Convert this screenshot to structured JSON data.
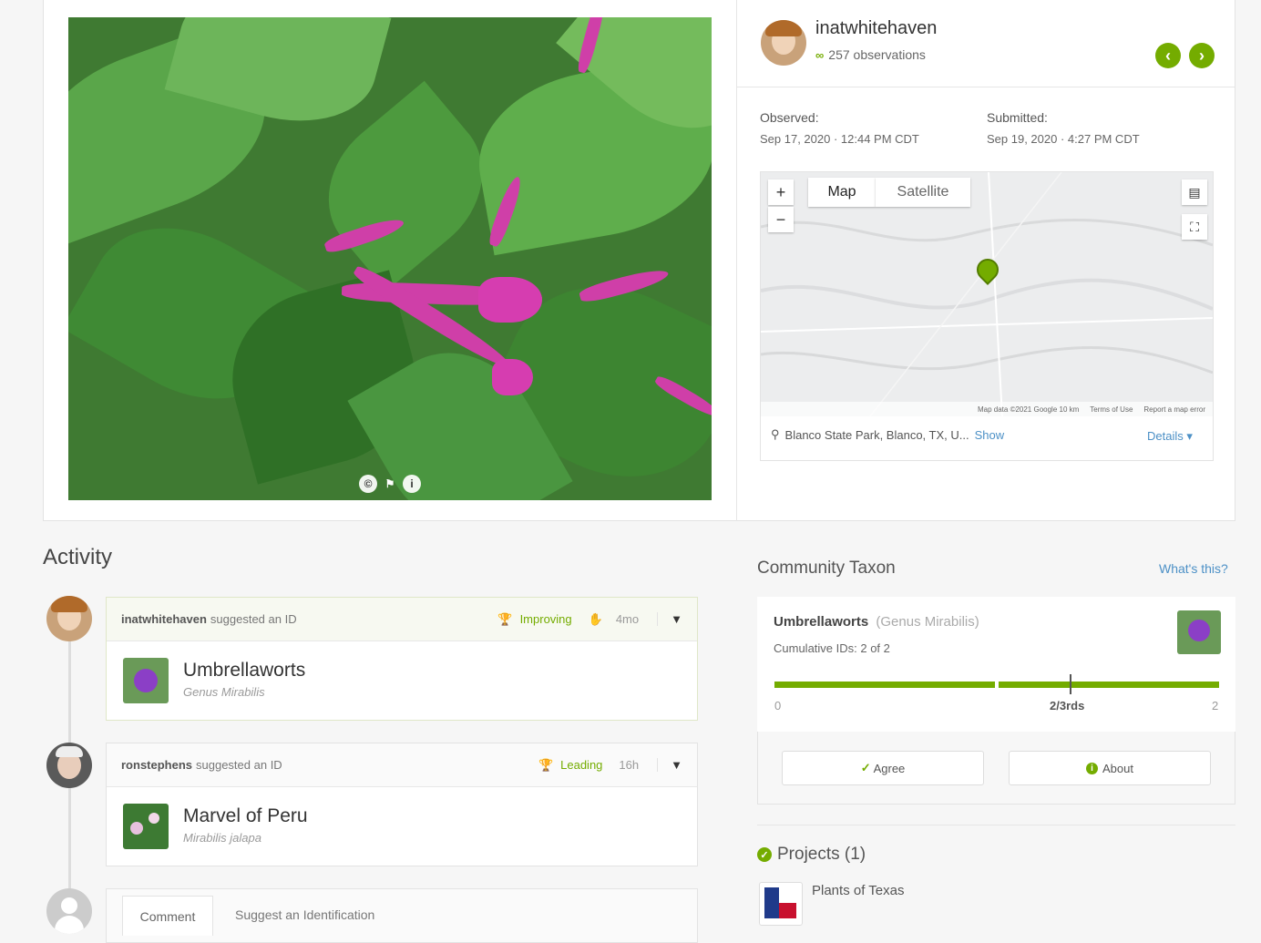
{
  "user": {
    "name": "inatwhitehaven",
    "observations": "257 observations"
  },
  "observed": {
    "label": "Observed:",
    "value": "Sep 17, 2020 · 12:44 PM CDT"
  },
  "submitted": {
    "label": "Submitted:",
    "value": "Sep 19, 2020 · 4:27 PM CDT"
  },
  "map": {
    "tab_map": "Map",
    "tab_satellite": "Satellite",
    "zoom_in": "+",
    "zoom_out": "−",
    "attribution": "Map data ©2021 Google   10 km",
    "terms": "Terms of Use",
    "report": "Report a map error",
    "location": "Blanco State Park, Blanco, TX, U...",
    "show": "Show",
    "details": "Details ▾"
  },
  "activity": {
    "title": "Activity",
    "items": [
      {
        "user": "inatwhitehaven",
        "action": "suggested an ID",
        "badge": "Improving",
        "time": "4mo",
        "common": "Umbrellaworts",
        "scientific": "Genus Mirabilis"
      },
      {
        "user": "ronstephens",
        "action": "suggested an ID",
        "badge": "Leading",
        "time": "16h",
        "common": "Marvel of Peru",
        "scientific": "Mirabilis jalapa"
      }
    ],
    "tab_comment": "Comment",
    "tab_suggest": "Suggest an Identification"
  },
  "community": {
    "title": "Community Taxon",
    "whats_this": "What's this?",
    "taxon_name": "Umbrellaworts",
    "taxon_rank": "(Genus Mirabilis)",
    "cumulative": "Cumulative IDs: 2 of 2",
    "scale_min": "0",
    "scale_mid": "2/3rds",
    "scale_max": "2",
    "agree": "Agree",
    "about": "About"
  },
  "projects": {
    "title": "Projects (1)",
    "items": [
      "Plants of Texas"
    ]
  },
  "colors": {
    "accent_green": "#74ac00",
    "link_blue": "#4c90c6",
    "flower_pink": "#cf3fa8"
  }
}
